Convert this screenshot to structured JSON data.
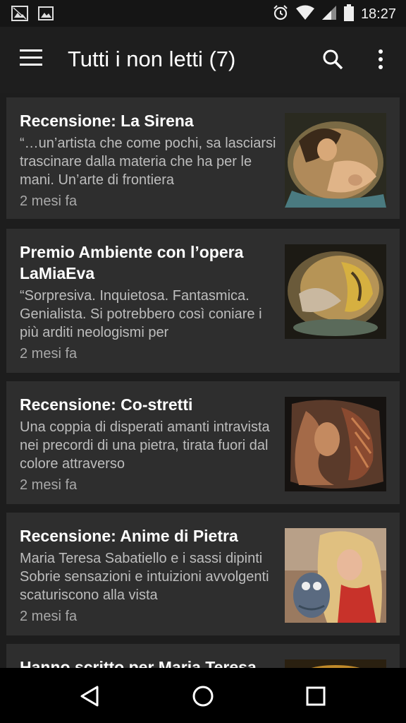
{
  "status_bar": {
    "time": "18:27",
    "icons": [
      "image-notification-icon",
      "photo-notification-icon",
      "alarm-icon",
      "wifi-icon",
      "signal-icon",
      "battery-icon"
    ]
  },
  "app_bar": {
    "title": "Tutti i non letti (7)",
    "icons": [
      "menu-icon",
      "search-icon",
      "more-vert-icon"
    ]
  },
  "articles": [
    {
      "title": "Recensione: La Sirena",
      "snippet": "“…un’artista che come pochi, sa lasciarsi trascinare dalla materia che ha per le mani. Un’arte di frontiera",
      "age": "2 mesi fa"
    },
    {
      "title": "Premio Ambiente con l’opera LaMiaEva",
      "snippet": "“Sorpresiva. Inquietosa. Fantasmica. Genialista. Si potrebbero così coniare i più arditi neologismi per",
      "age": "2 mesi fa"
    },
    {
      "title": "Recensione: Co-stretti",
      "snippet": "Una coppia di disperati amanti intravista nei precordi di una pietra, tirata fuori dal colore attraverso",
      "age": "2 mesi fa"
    },
    {
      "title": "Recensione: Anime di Pietra",
      "snippet": "Maria Teresa Sabatiello e i sassi dipinti Sobrie sensazioni e intuizioni avvolgenti scaturiscono alla vista",
      "age": "2 mesi fa"
    },
    {
      "title": "Hanno scritto per Maria Teresa"
    }
  ],
  "nav_bar": {
    "icons": [
      "back-icon",
      "home-icon",
      "recents-icon"
    ]
  }
}
